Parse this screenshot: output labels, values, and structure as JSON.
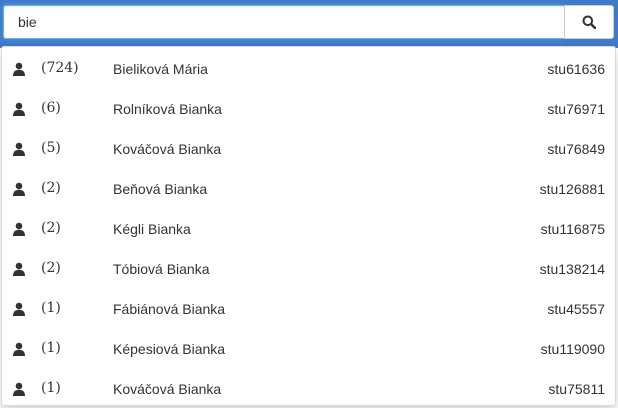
{
  "search": {
    "value": "bie",
    "placeholder": "",
    "button_icon": "search-icon"
  },
  "colors": {
    "header_bg": "#3f7ac8",
    "focus_border": "#66afe9",
    "text": "#333333"
  },
  "results": [
    {
      "icon": "user-icon",
      "count": "(724)",
      "name": "Bieliková Mária",
      "login": "stu61636"
    },
    {
      "icon": "user-icon",
      "count": "(6)",
      "name": "Rolníková Bianka",
      "login": "stu76971"
    },
    {
      "icon": "user-icon",
      "count": "(5)",
      "name": "Kováčová Bianka",
      "login": "stu76849"
    },
    {
      "icon": "user-icon",
      "count": "(2)",
      "name": "Beňová Bianka",
      "login": "stu126881"
    },
    {
      "icon": "user-icon",
      "count": "(2)",
      "name": "Kégli Bianka",
      "login": "stu116875"
    },
    {
      "icon": "user-icon",
      "count": "(2)",
      "name": "Tóbiová Bianka",
      "login": "stu138214"
    },
    {
      "icon": "user-icon",
      "count": "(1)",
      "name": "Fábiánová Bianka",
      "login": "stu45557"
    },
    {
      "icon": "user-icon",
      "count": "(1)",
      "name": "Képesiová Bianka",
      "login": "stu119090"
    },
    {
      "icon": "user-icon",
      "count": "(1)",
      "name": "Kováčová Bianka",
      "login": "stu75811"
    }
  ]
}
